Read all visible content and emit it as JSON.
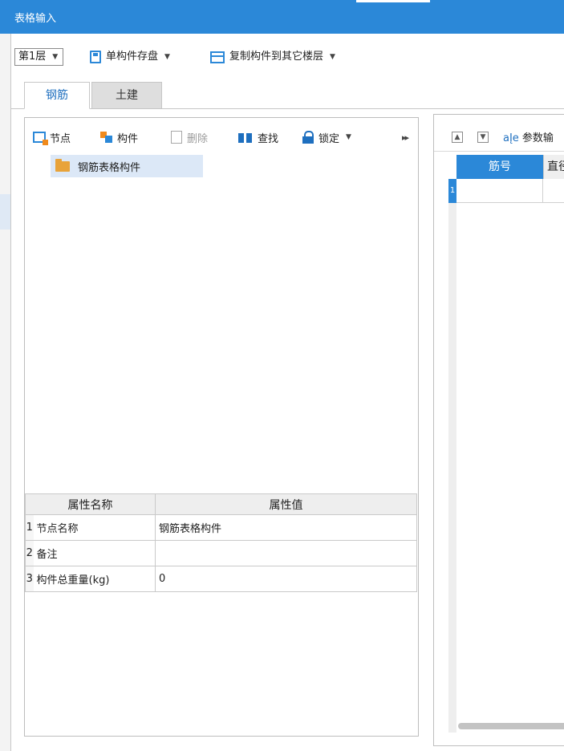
{
  "window": {
    "title": "表格输入"
  },
  "toolbar": {
    "floor_select": "第1层",
    "save_component_label": "单构件存盘",
    "copy_component_label": "复制构件到其它楼层"
  },
  "tabs": [
    {
      "label": "钢筋",
      "active": true
    },
    {
      "label": "土建",
      "active": false
    }
  ],
  "left_panel": {
    "toolbar": {
      "node": "节点",
      "component": "构件",
      "delete": "删除",
      "find": "查找",
      "lock": "锁定"
    },
    "tree": {
      "root": "钢筋表格构件"
    },
    "properties": {
      "headers": [
        "属性名称",
        "属性值"
      ],
      "rows": [
        {
          "index": "1",
          "name": "节点名称",
          "value": "钢筋表格构件"
        },
        {
          "index": "2",
          "name": "备注",
          "value": ""
        },
        {
          "index": "3",
          "name": "构件总重量(kg)",
          "value": "0"
        }
      ]
    }
  },
  "right_panel": {
    "toolbar": {
      "param_label": "参数输"
    },
    "grid": {
      "headers": [
        "筋号",
        "直径"
      ],
      "row_numbers": [
        "1"
      ]
    }
  },
  "colors": {
    "accent": "#2b88d8",
    "folder": "#e8a33a",
    "selection": "#dce8f7"
  }
}
